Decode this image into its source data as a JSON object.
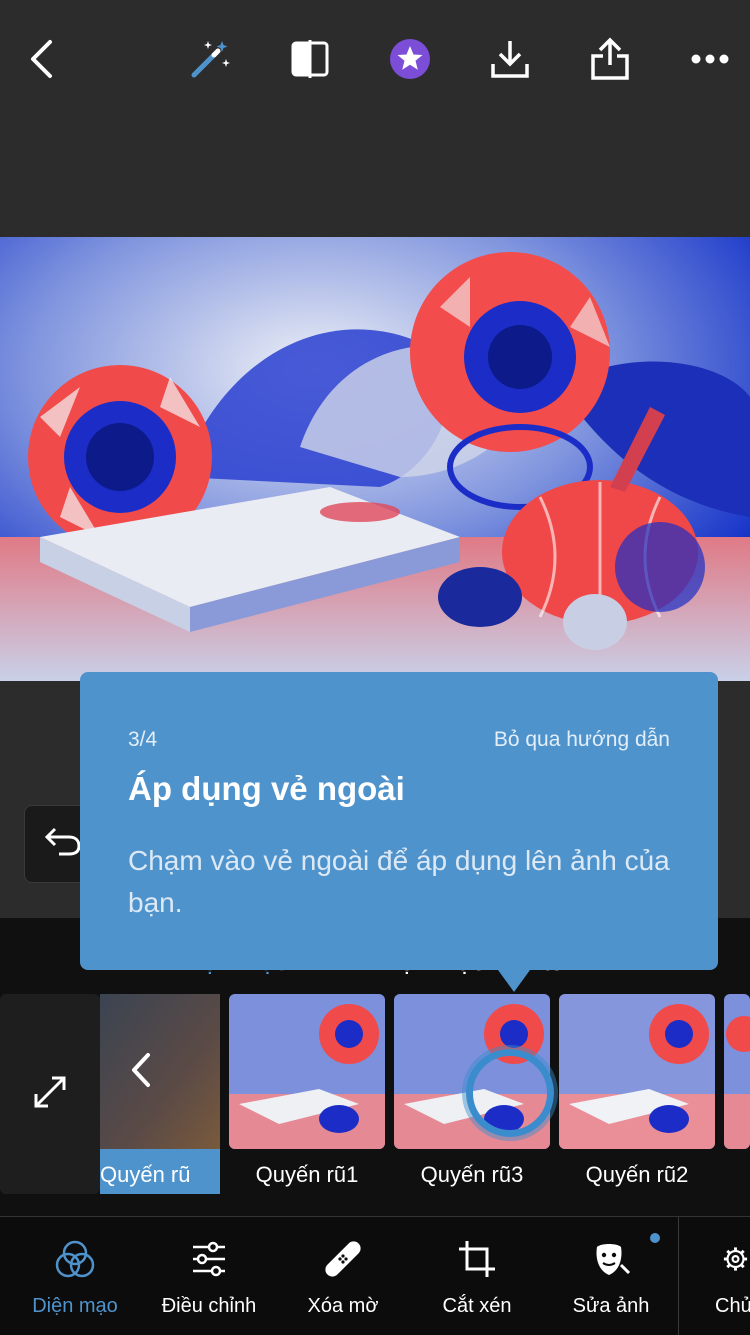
{
  "topbar": {
    "icons": [
      "back-chevron-icon",
      "magic-wand-icon",
      "compare-icon",
      "premium-star-icon",
      "download-icon",
      "share-icon",
      "more-icon"
    ]
  },
  "tooltip": {
    "step": "3/4",
    "skip": "Bỏ qua hướng dẫn",
    "title": "Áp dụng vẻ ngoài",
    "body": "Chạm vào vẻ ngoài để áp dụng lên ảnh của bạn."
  },
  "tabs": {
    "left": "Diện mạo",
    "right": "Diện mạo của tôi"
  },
  "thumbnails": {
    "back_label": "Quyến rũ",
    "items": [
      "Quyến rũ1",
      "Quyến rũ3",
      "Quyến rũ2"
    ]
  },
  "bottombar": {
    "items": [
      "Diện mạo",
      "Điều chỉnh",
      "Xóa mờ",
      "Cắt xén",
      "Sửa ảnh",
      "Chủ"
    ]
  },
  "colors": {
    "accent": "#4f93cc",
    "premium": "#7c4dd6",
    "background": "#2c2c2c"
  }
}
